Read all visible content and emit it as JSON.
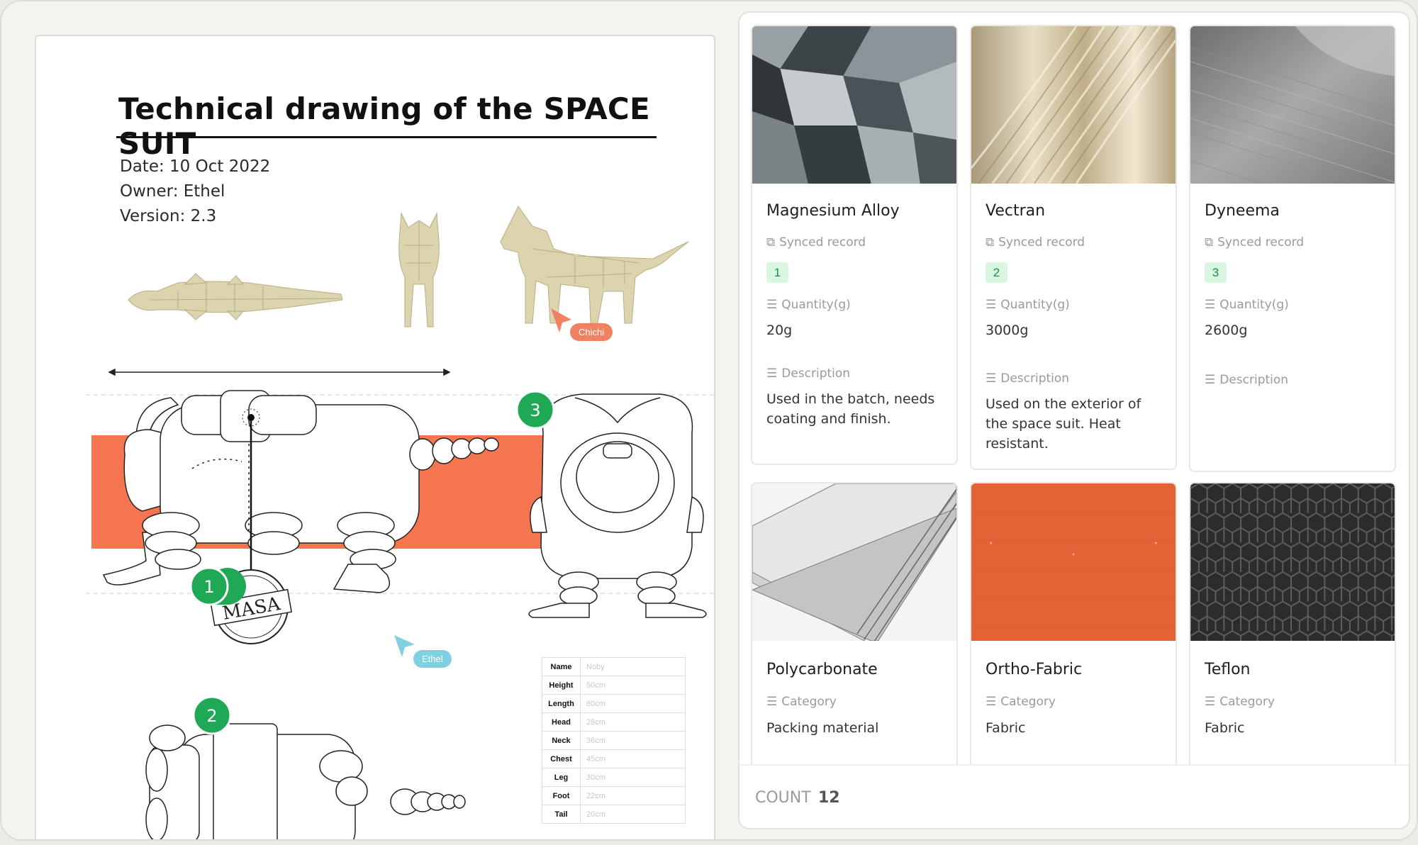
{
  "document": {
    "title": "Technical drawing of the SPACE SUIT",
    "date": "Date: 10 Oct 2022",
    "owner": "Owner: Ethel",
    "version": "Version: 2.3",
    "markers": [
      "1",
      "2",
      "3"
    ],
    "stamp_text": "MASA",
    "cursors": [
      {
        "name": "Chichi",
        "color": "#f08263"
      },
      {
        "name": "Ethel",
        "color": "#7fd0e0"
      }
    ],
    "spec_table": [
      {
        "key": "Name",
        "value": "Noby"
      },
      {
        "key": "Height",
        "value": "50cm"
      },
      {
        "key": "Length",
        "value": "80cm"
      },
      {
        "key": "Head",
        "value": "28cm"
      },
      {
        "key": "Neck",
        "value": "36cm"
      },
      {
        "key": "Chest",
        "value": "45cm"
      },
      {
        "key": "Leg",
        "value": "30cm"
      },
      {
        "key": "Foot",
        "value": "22cm"
      },
      {
        "key": "Tail",
        "value": "20cm"
      }
    ],
    "accent_color": "#f57551",
    "marker_color": "#1fa855"
  },
  "gallery": {
    "cards": [
      {
        "title": "Magnesium Alloy",
        "synced_label": "Synced record",
        "badge": "1",
        "quantity_label": "Quantity(g)",
        "quantity": "20g",
        "description_label": "Description",
        "description": "Used in the batch, needs coating and finish."
      },
      {
        "title": "Vectran",
        "synced_label": "Synced record",
        "badge": "2",
        "quantity_label": "Quantity(g)",
        "quantity": "3000g",
        "description_label": "Description",
        "description": "Used on the exterior of the space suit. Heat resistant."
      },
      {
        "title": "Dyneema",
        "synced_label": "Synced record",
        "badge": "3",
        "quantity_label": "Quantity(g)",
        "quantity": "2600g",
        "description_label": "Description",
        "description": ""
      },
      {
        "title": "Polycarbonate",
        "category_label": "Category",
        "category": "Packing material"
      },
      {
        "title": "Ortho-Fabric",
        "category_label": "Category",
        "category": "Fabric"
      },
      {
        "title": "Teflon",
        "category_label": "Category",
        "category": "Fabric"
      }
    ],
    "count_label": "COUNT",
    "count_value": "12"
  }
}
